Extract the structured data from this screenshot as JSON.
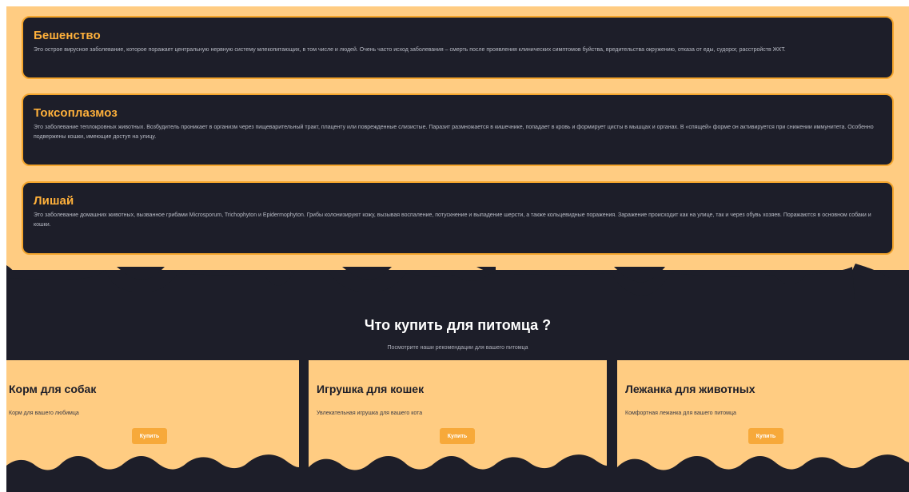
{
  "diseases": [
    {
      "title": "Бешенство",
      "text": "Это острое вирусное заболевание, которое поражает центральную нервную систему млекопитающих, в том числе и людей. Очень часто исход заболевания – смерть после проявления клинических симптомов буйства, вредительства окружению, отказа от еды, судорог, расстройств ЖКТ."
    },
    {
      "title": "Токсоплазмоз",
      "text": "Это заболевание теплокровных животных. Возбудитель проникает в организм через пищеварительный тракт, плаценту или поврежденные слизистые. Паразит размножается в кишечнике, попадает в кровь и формирует цисты в мышцах и органах. В «спящей» форме он активируется при снижении иммунитета. Особенно подвержены кошки, имеющие доступ на улицу."
    },
    {
      "title": "Лишай",
      "text": "Это заболевание домашних животных, вызванное грибами Microsporum, Trichophyton и Epidermophyton. Грибы колонизируют кожу, вызывая воспаление, потускнение и выпадение шерсти, а также кольцевидные поражения. Заражение происходит как на улице, так и через обувь хозяев. Поражаются в основном собаки и кошки."
    }
  ],
  "shop": {
    "title": "Что купить для питомца ?",
    "subtitle": "Посмотрите наши рекомендации для вашего питомца",
    "products": [
      {
        "title": "Корм для собак",
        "description": "Корм для вашего любимца",
        "button": "Купить"
      },
      {
        "title": "Игрушка для кошек",
        "description": "Увлекательная игрушка для вашего кота",
        "button": "Купить"
      },
      {
        "title": "Лежанка для животных",
        "description": "Комфортная лежанка для вашего питомца",
        "button": "Купить"
      }
    ]
  },
  "colors": {
    "background_dark": "#1d1e29",
    "accent_yellow": "#ffcc82",
    "accent_orange": "#f4a52c",
    "button": "#f7a93a"
  }
}
